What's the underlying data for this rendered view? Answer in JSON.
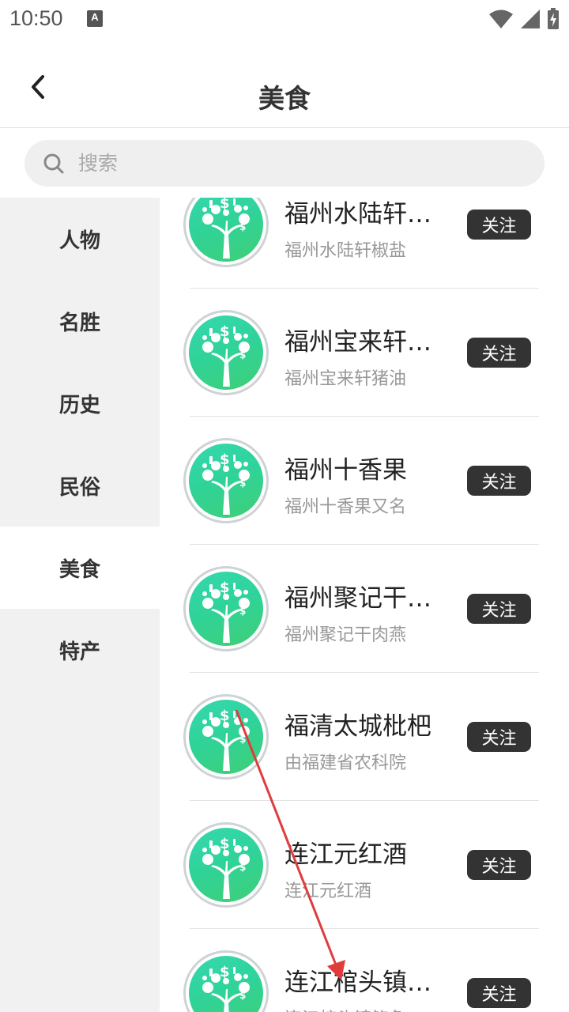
{
  "status_bar": {
    "time": "10:50",
    "notification_icon": "A",
    "icons": [
      "wifi-icon",
      "signal-icon",
      "battery-charging-icon"
    ]
  },
  "header": {
    "title": "美食",
    "back_icon": "chevron-left-icon"
  },
  "search": {
    "placeholder": "搜索",
    "icon": "search-icon"
  },
  "sidebar": {
    "items": [
      {
        "label": "人物",
        "active": false
      },
      {
        "label": "名胜",
        "active": false
      },
      {
        "label": "历史",
        "active": false
      },
      {
        "label": "民俗",
        "active": false
      },
      {
        "label": "美食",
        "active": true
      },
      {
        "label": "特产",
        "active": false
      }
    ]
  },
  "list": {
    "items": [
      {
        "title": "福州水陆轩椒盐",
        "subtitle": "福州水陆轩椒盐",
        "follow_label": "关注"
      },
      {
        "title": "福州宝来轩猪油",
        "subtitle": "福州宝来轩猪油",
        "follow_label": "关注"
      },
      {
        "title": "福州十香果",
        "subtitle": "福州十香果又名",
        "follow_label": "关注"
      },
      {
        "title": "福州聚记干肉燕",
        "subtitle": "福州聚记干肉燕",
        "follow_label": "关注"
      },
      {
        "title": "福清太城枇杷",
        "subtitle": "由福建省农科院",
        "follow_label": "关注"
      },
      {
        "title": "连江元红酒",
        "subtitle": "连江元红酒",
        "follow_label": "关注"
      },
      {
        "title": "连江棺头镇鲍鱼",
        "subtitle": "连江棺头镇鲍鱼",
        "follow_label": "关注"
      }
    ]
  },
  "colors": {
    "accent_green": "#2fd39a",
    "button_dark": "#333333",
    "sidebar_bg": "#f1f1f1",
    "annotation_arrow": "#e03c3c"
  }
}
